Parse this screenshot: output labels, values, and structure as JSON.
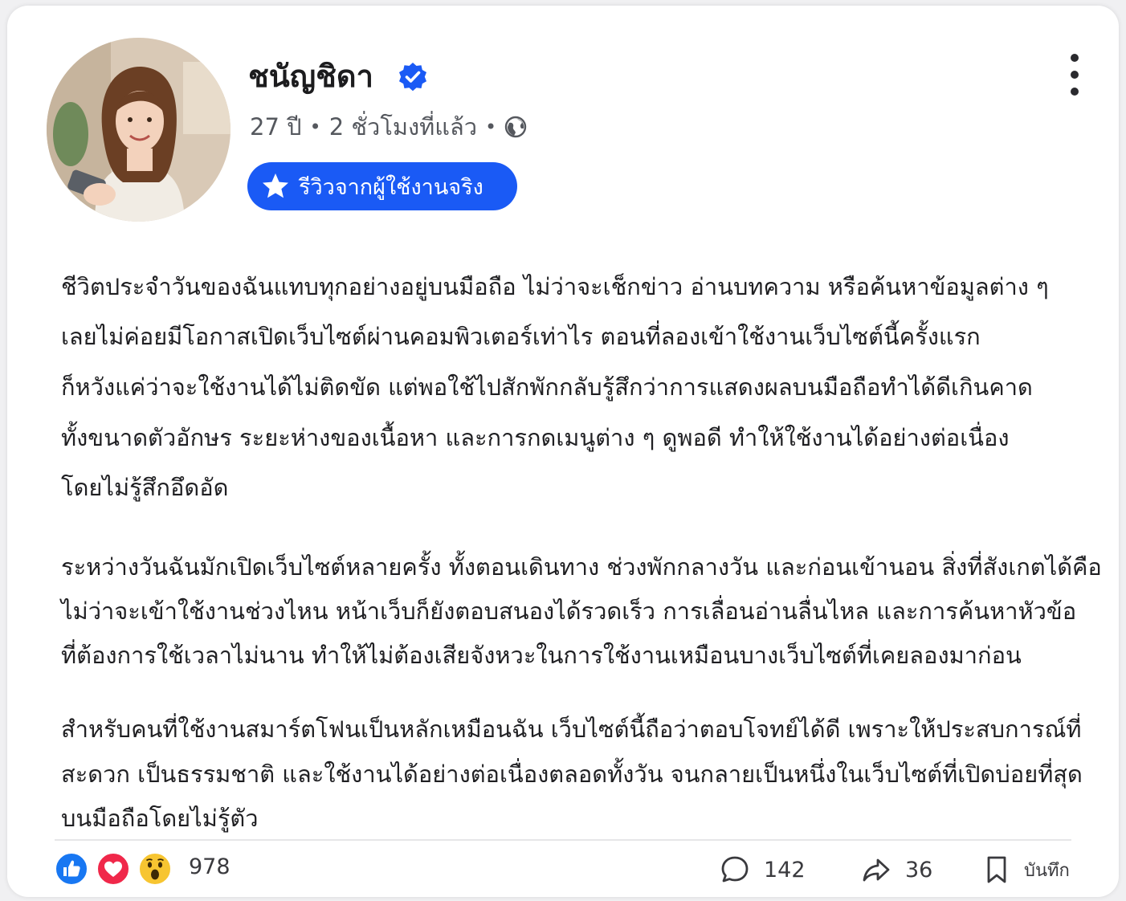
{
  "post": {
    "author": {
      "name": "ชนัญชิดา",
      "verified": true
    },
    "meta": {
      "age": "27 ปี",
      "time": "2 ชั่วโมงที่แล้ว",
      "visibility_icon": "globe-icon"
    },
    "badge": {
      "icon": "star-icon",
      "label": "รีวิวจากผู้ใช้งานจริง"
    },
    "menu_icon": "more-vertical-icon",
    "paragraphs": [
      [
        "ชีวิตประจำวันของฉันแทบทุกอย่างอยู่บนมือถือ ไม่ว่าจะเช็กข่าว อ่านบทความ หรือค้นหาข้อมูลต่าง ๆ",
        "เลยไม่ค่อยมีโอกาสเปิดเว็บไซต์ผ่านคอมพิวเตอร์เท่าไร ตอนที่ลองเข้าใช้งานเว็บไซต์นี้ครั้งแรก",
        "ก็หวังแค่ว่าจะใช้งานได้ไม่ติดขัด แต่พอใช้ไปสักพักกลับรู้สึกว่าการแสดงผลบนมือถือทำได้ดีเกินคาด",
        "ทั้งขนาดตัวอักษร ระยะห่างของเนื้อหา และการกดเมนูต่าง ๆ ดูพอดี ทำให้ใช้งานได้อย่างต่อเนื่อง",
        "โดยไม่รู้สึกอึดอัด"
      ],
      [
        "ระหว่างวันฉันมักเปิดเว็บไซต์หลายครั้ง ทั้งตอนเดินทาง ช่วงพักกลางวัน และก่อนเข้านอน สิ่งที่สังเกตได้คือ",
        "ไม่ว่าจะเข้าใช้งานช่วงไหน หน้าเว็บก็ยังตอบสนองได้รวดเร็ว การเลื่อนอ่านลื่นไหล และการค้นหาหัวข้อ",
        "ที่ต้องการใช้เวลาไม่นาน ทำให้ไม่ต้องเสียจังหวะในการใช้งานเหมือนบางเว็บไซต์ที่เคยลองมาก่อน"
      ],
      [
        "สำหรับคนที่ใช้งานสมาร์ตโฟนเป็นหลักเหมือนฉัน เว็บไซต์นี้ถือว่าตอบโจทย์ได้ดี เพราะให้ประสบการณ์ที่",
        "สะดวก เป็นธรรมชาติ และใช้งานได้อย่างต่อเนื่องตลอดทั้งวัน จนกลายเป็นหนึ่งในเว็บไซต์ที่เปิดบ่อยที่สุด",
        "บนมือถือโดยไม่รู้ตัว"
      ]
    ],
    "reactions": {
      "icons": [
        "like-icon",
        "love-icon",
        "wow-icon"
      ],
      "count": "978"
    },
    "actions": {
      "comments": "142",
      "shares": "36",
      "save_label": "บันทึก"
    },
    "colors": {
      "accent": "#1a5af5",
      "like": "#1877f2",
      "love": "#f0284a",
      "wow": "#f7c531"
    }
  }
}
